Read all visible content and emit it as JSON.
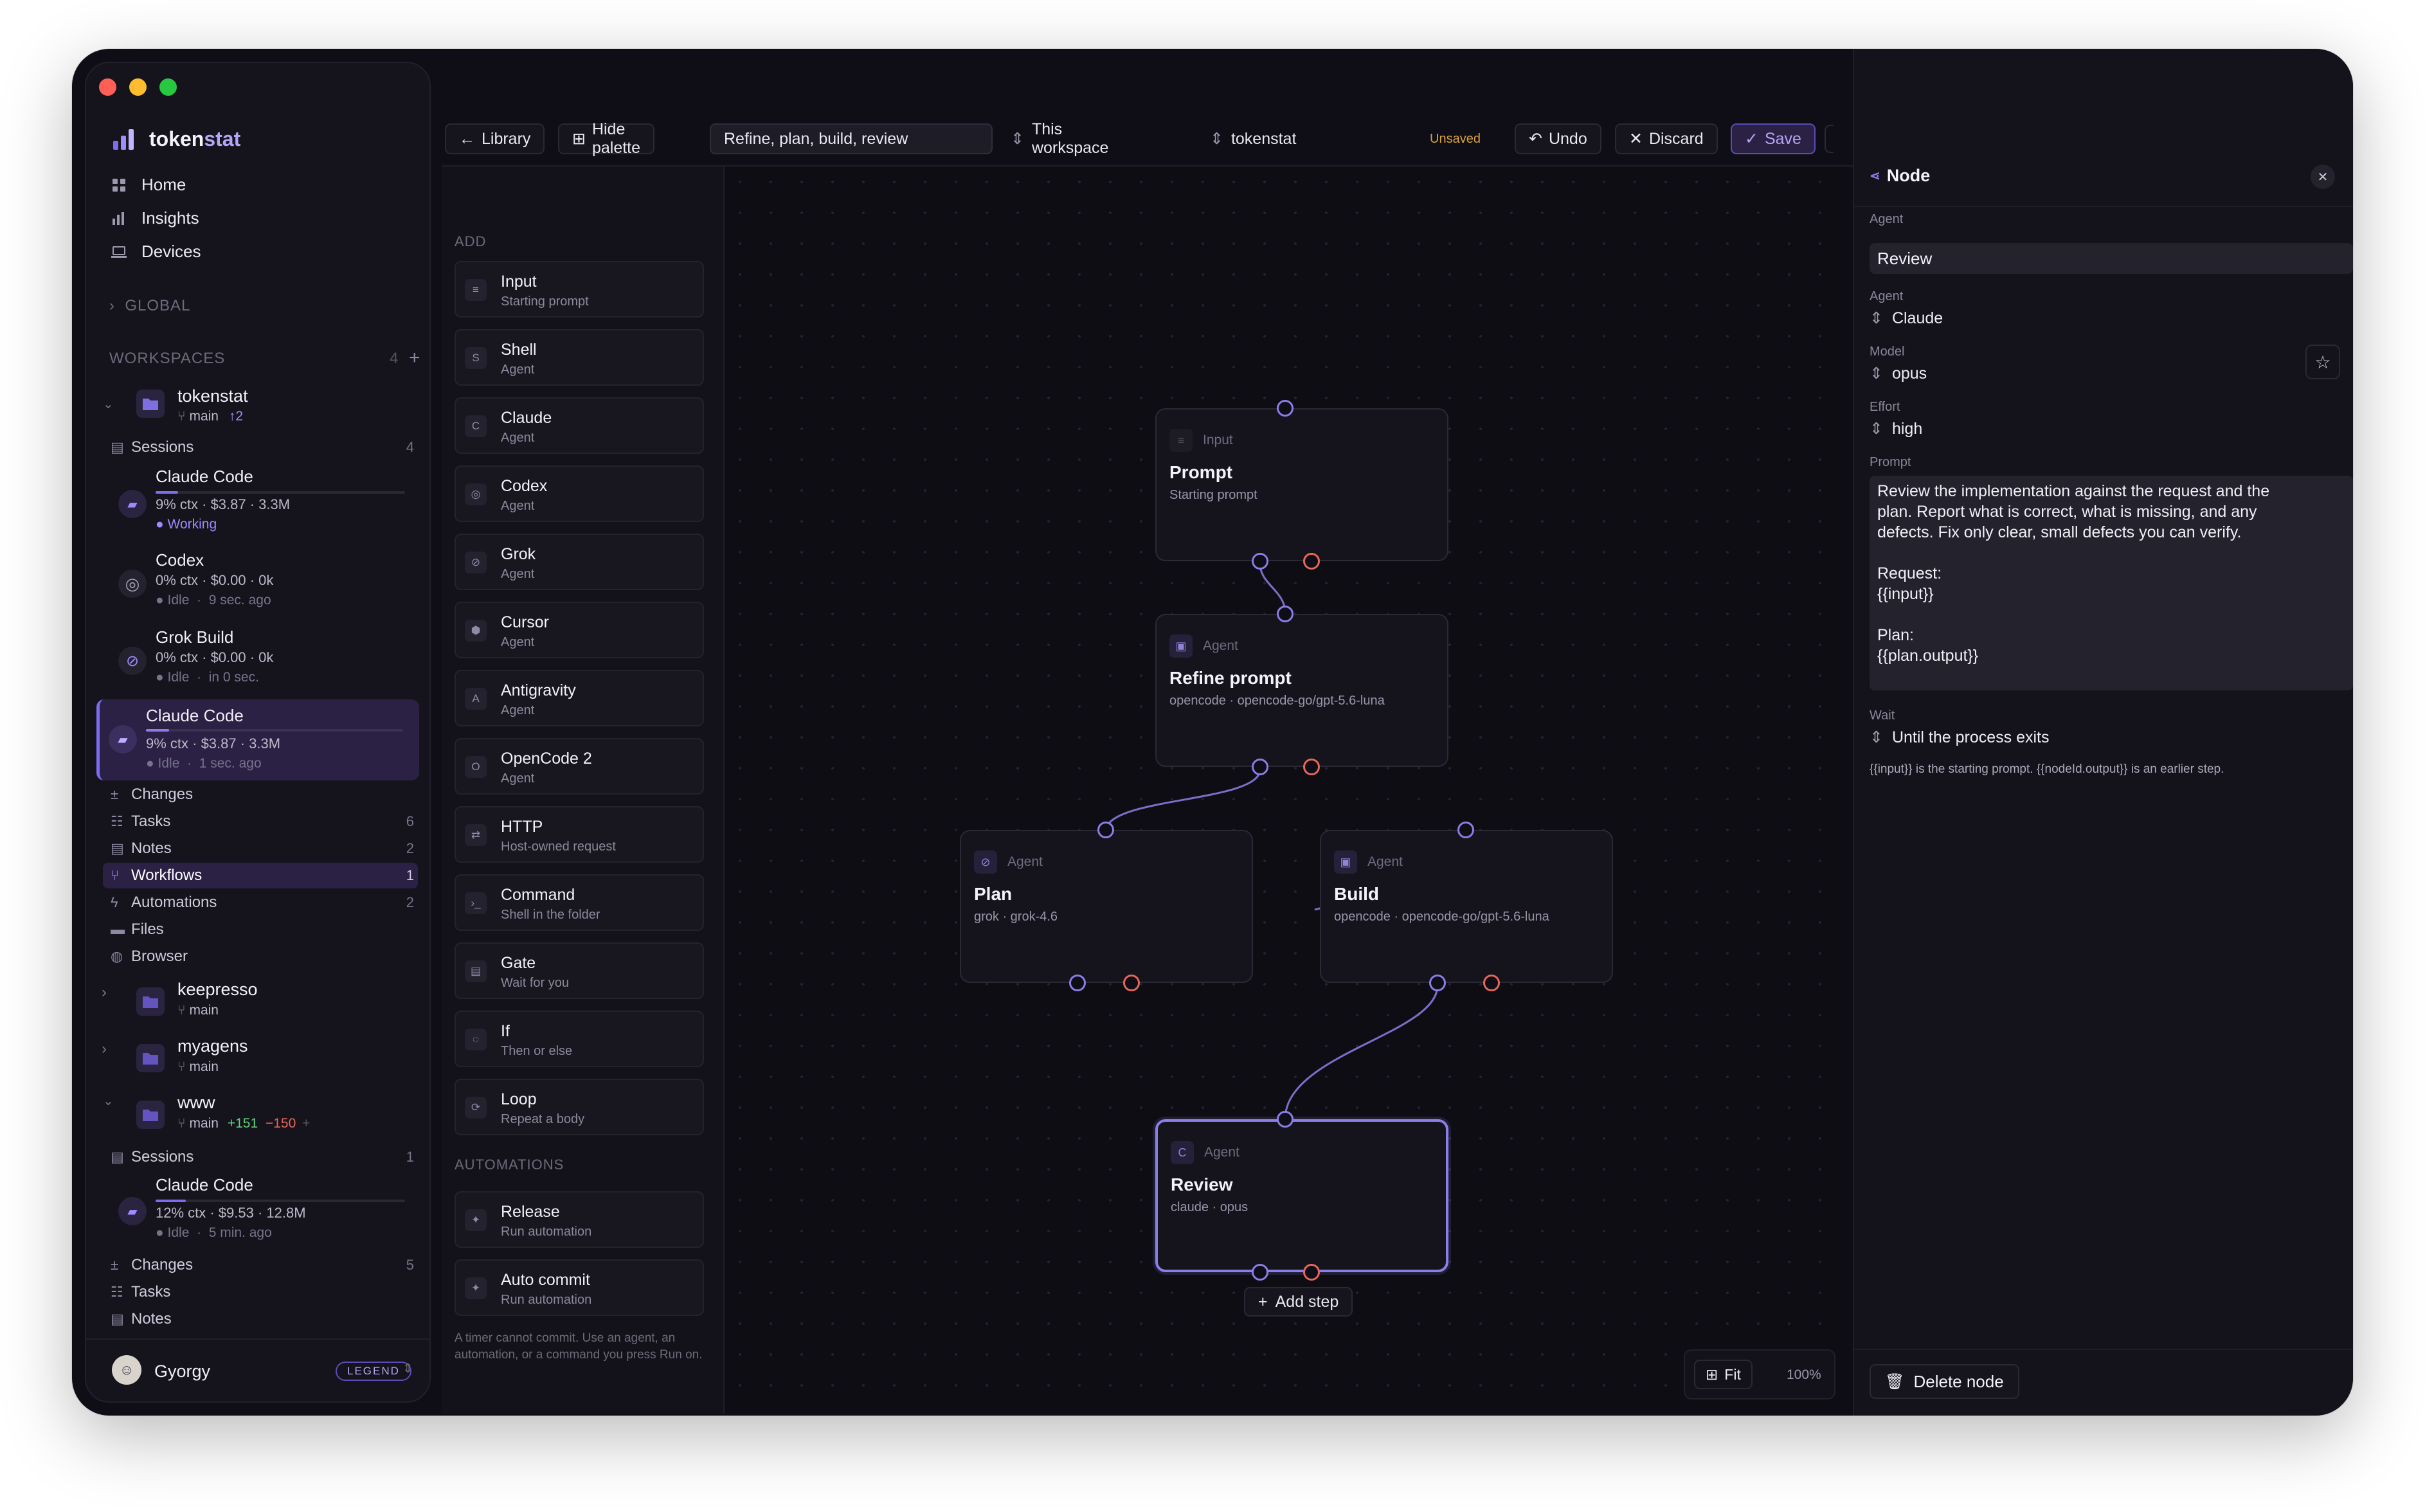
{
  "sidebar": {
    "brand": {
      "name_a": "token",
      "name_b": "stat"
    },
    "nav": [
      {
        "label": "Home"
      },
      {
        "label": "Insights"
      },
      {
        "label": "Devices"
      }
    ],
    "global_label": "GLOBAL",
    "workspaces_label": "WORKSPACES",
    "workspaces_count": "4",
    "ws_tokenstat": {
      "name": "tokenstat",
      "branch": "main",
      "ahead": "↑2"
    },
    "sessions_label": "Sessions",
    "sessions_count": "4",
    "sessions": [
      {
        "name": "Claude Code",
        "meta": "9% ctx · $3.87 · 3.3M",
        "status": "Working",
        "time": ""
      },
      {
        "name": "Codex",
        "meta": "0% ctx · $0.00 · 0k",
        "status": "Idle",
        "time": "9 sec. ago"
      },
      {
        "name": "Grok Build",
        "meta": "0% ctx · $0.00 · 0k",
        "status": "Idle",
        "time": "in 0 sec."
      },
      {
        "name": "Claude Code",
        "meta": "9% ctx · $3.87 · 3.3M",
        "status": "Idle",
        "time": "1 sec. ago"
      }
    ],
    "ws_rows": [
      {
        "label": "Changes",
        "count": ""
      },
      {
        "label": "Tasks",
        "count": "6"
      },
      {
        "label": "Notes",
        "count": "2"
      },
      {
        "label": "Workflows",
        "count": "1"
      },
      {
        "label": "Automations",
        "count": "2"
      },
      {
        "label": "Files",
        "count": ""
      },
      {
        "label": "Browser",
        "count": ""
      }
    ],
    "ws_keepresso": {
      "name": "keepresso",
      "branch": "main"
    },
    "ws_myagens": {
      "name": "myagens",
      "branch": "main"
    },
    "ws_www": {
      "name": "www",
      "branch": "main",
      "added": "+151",
      "removed": "−150"
    },
    "www_sessions_count": "1",
    "www_session": {
      "name": "Claude Code",
      "meta": "12% ctx · $9.53 · 12.8M",
      "status": "Idle",
      "time": "5 min. ago"
    },
    "www_rows": [
      {
        "label": "Changes",
        "count": "5"
      },
      {
        "label": "Tasks",
        "count": ""
      },
      {
        "label": "Notes",
        "count": ""
      }
    ],
    "user": {
      "name": "Gyorgy",
      "badge": "LEGEND"
    }
  },
  "toolbar": {
    "library": "Library",
    "hide_palette": "Hide palette",
    "workflow_name": "Refine, plan, build, review",
    "scope": "This workspace",
    "project": "tokenstat",
    "unsaved": "Unsaved",
    "undo": "Undo",
    "discard": "Discard",
    "save": "Save"
  },
  "palette": {
    "add_label": "ADD",
    "items": [
      {
        "title": "Input",
        "sub": "Starting prompt",
        "icon": "≡"
      },
      {
        "title": "Shell",
        "sub": "Agent",
        "icon": "S"
      },
      {
        "title": "Claude",
        "sub": "Agent",
        "icon": "C"
      },
      {
        "title": "Codex",
        "sub": "Agent",
        "icon": "◎"
      },
      {
        "title": "Grok",
        "sub": "Agent",
        "icon": "⊘"
      },
      {
        "title": "Cursor",
        "sub": "Agent",
        "icon": "⬢"
      },
      {
        "title": "Antigravity",
        "sub": "Agent",
        "icon": "A"
      },
      {
        "title": "OpenCode 2",
        "sub": "Agent",
        "icon": "O"
      },
      {
        "title": "HTTP",
        "sub": "Host-owned request",
        "icon": "⇄"
      },
      {
        "title": "Command",
        "sub": "Shell in the folder",
        "icon": "›_"
      },
      {
        "title": "Gate",
        "sub": "Wait for you",
        "icon": "▤"
      },
      {
        "title": "If",
        "sub": "Then or else",
        "icon": "◌"
      },
      {
        "title": "Loop",
        "sub": "Repeat a body",
        "icon": "⟳"
      }
    ],
    "automations_label": "AUTOMATIONS",
    "automations": [
      {
        "title": "Release",
        "sub": "Run automation",
        "icon": "✦"
      },
      {
        "title": "Auto commit",
        "sub": "Run automation",
        "icon": "✦"
      }
    ],
    "footnote": "A timer cannot commit. Use an agent, an automation, or a command you press Run on."
  },
  "canvas": {
    "nodes": {
      "prompt": {
        "type": "Input",
        "name": "Prompt",
        "sub": "Starting prompt"
      },
      "refine": {
        "type": "Agent",
        "name": "Refine prompt",
        "sub": "opencode · opencode-go/gpt-5.6-luna"
      },
      "plan": {
        "type": "Agent",
        "name": "Plan",
        "sub": "grok · grok-4.6"
      },
      "build": {
        "type": "Agent",
        "name": "Build",
        "sub": "opencode · opencode-go/gpt-5.6-luna"
      },
      "review": {
        "type": "Agent",
        "name": "Review",
        "sub": "claude · opus"
      }
    },
    "add_step": "Add step",
    "fit": "Fit",
    "zoom": "100%"
  },
  "panel": {
    "title": "Node",
    "agent_label": "Agent",
    "agent_name": "Review",
    "agent_sel_label": "Agent",
    "agent_value": "Claude",
    "model_label": "Model",
    "model_value": "opus",
    "effort_label": "Effort",
    "effort_value": "high",
    "prompt_label": "Prompt",
    "prompt_lines": [
      "Review the implementation against the request and the",
      "plan. Report what is correct, what is missing, and any",
      "defects. Fix only clear, small defects you can verify.",
      "",
      "Request:",
      "{{input}}",
      "",
      "Plan:",
      "{{plan.output}}"
    ],
    "wait_label": "Wait",
    "wait_value": "Until the process exits",
    "hint": "{{input}} is the starting prompt. {{nodeId.output}} is an earlier step.",
    "delete": "Delete node"
  },
  "colors": {
    "accent": "#8a7ee8",
    "danger_port": "#e8665a",
    "working": "#9b8cff",
    "unsaved": "#d9a13a"
  }
}
